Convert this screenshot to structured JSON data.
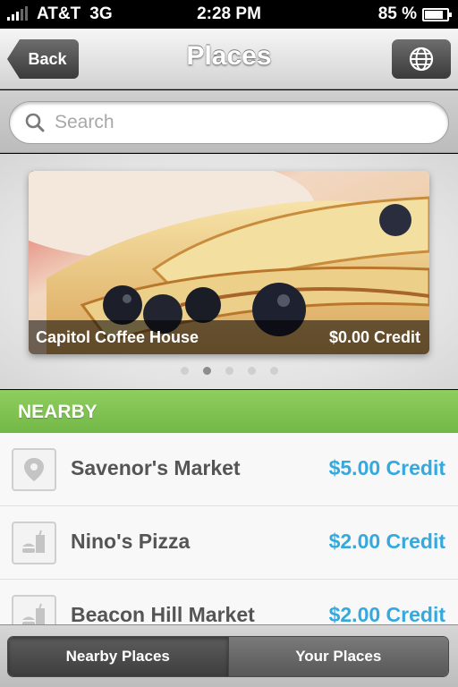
{
  "status_bar": {
    "carrier": "AT&T",
    "network": "3G",
    "time": "2:28 PM",
    "battery_text": "85 %",
    "battery_level": 0.85
  },
  "navbar": {
    "back_label": "Back",
    "title": "Places",
    "globe_icon": "globe-icon"
  },
  "search": {
    "placeholder": "Search",
    "value": "",
    "icon": "search-icon"
  },
  "featured": {
    "name": "Capitol Coffee House",
    "credit": "$0.00 Credit",
    "page_count": 5,
    "active_page": 2
  },
  "nearby": {
    "header": "NEARBY",
    "items": [
      {
        "name": "Savenor's Market",
        "credit": "$5.00 Credit",
        "icon": "location-pin-icon"
      },
      {
        "name": "Nino's Pizza",
        "credit": "$2.00 Credit",
        "icon": "fast-food-icon"
      },
      {
        "name": "Beacon Hill Market",
        "credit": "$2.00 Credit",
        "icon": "fast-food-icon"
      }
    ]
  },
  "tabbar": {
    "tabs": [
      {
        "label": "Nearby Places",
        "active": true
      },
      {
        "label": "Your Places",
        "active": false
      }
    ]
  },
  "colors": {
    "section_header": "#7cc04e",
    "credit_text": "#35a9dd"
  }
}
